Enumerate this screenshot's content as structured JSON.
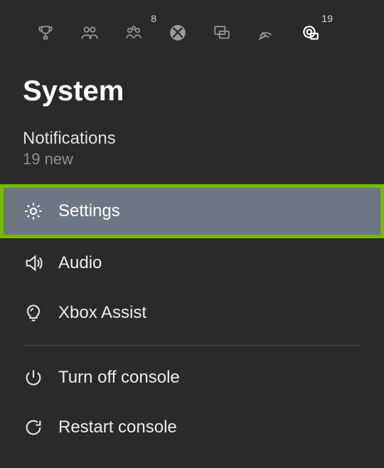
{
  "topbar": {
    "items": [
      {
        "name": "achievements-icon",
        "badge": null
      },
      {
        "name": "friends-icon",
        "badge": null
      },
      {
        "name": "party-icon",
        "badge": "8"
      },
      {
        "name": "xbox-icon",
        "badge": null
      },
      {
        "name": "messages-icon",
        "badge": null
      },
      {
        "name": "broadcast-icon",
        "badge": null
      },
      {
        "name": "system-icon",
        "badge": "19"
      }
    ]
  },
  "page_title": "System",
  "notifications": {
    "label": "Notifications",
    "count_text": "19 new"
  },
  "menu": {
    "items": [
      {
        "name": "settings",
        "label": "Settings",
        "icon": "gear-icon",
        "selected": true
      },
      {
        "name": "audio",
        "label": "Audio",
        "icon": "speaker-icon",
        "selected": false
      },
      {
        "name": "xbox-assist",
        "label": "Xbox Assist",
        "icon": "lightbulb-icon",
        "selected": false
      }
    ],
    "power_items": [
      {
        "name": "turn-off",
        "label": "Turn off console",
        "icon": "power-icon"
      },
      {
        "name": "restart",
        "label": "Restart console",
        "icon": "restart-icon"
      }
    ]
  }
}
